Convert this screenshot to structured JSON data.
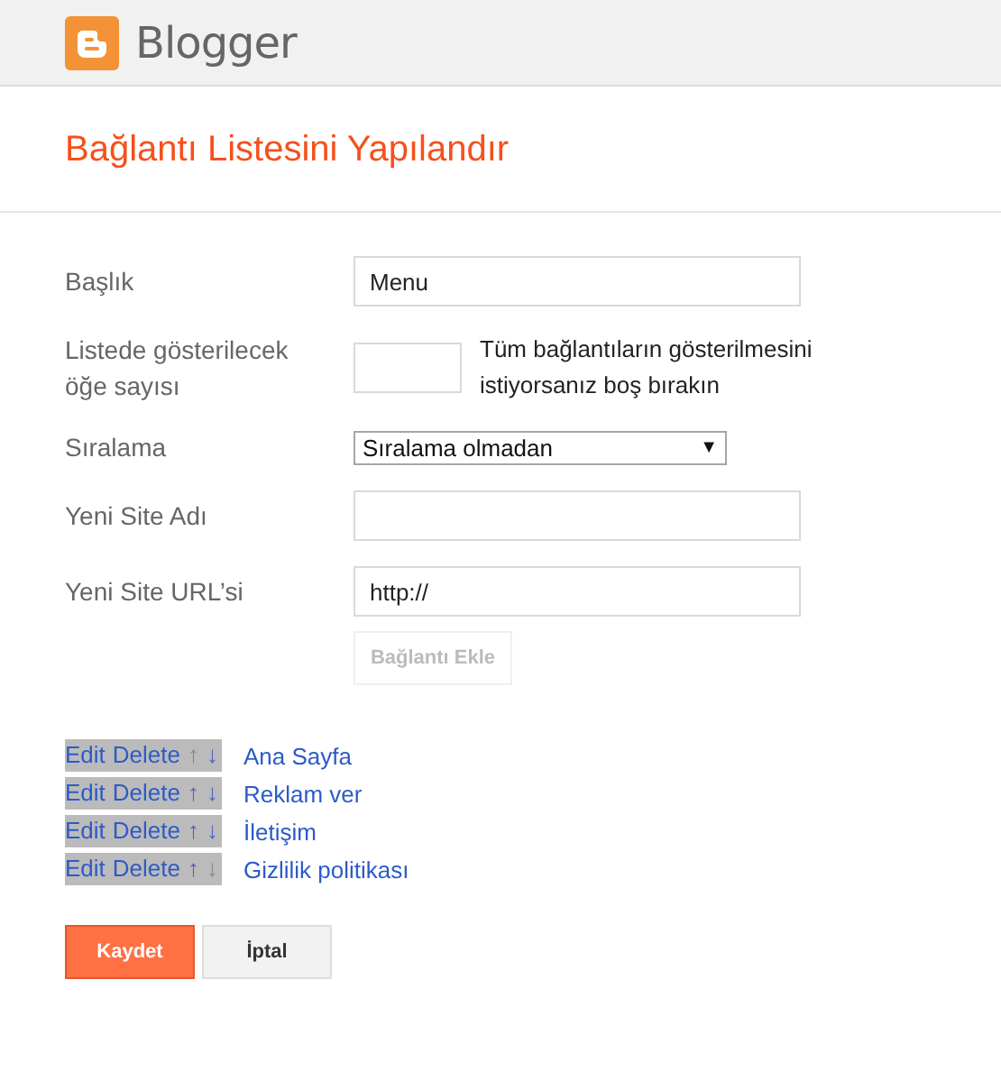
{
  "header": {
    "brand": "Blogger"
  },
  "title": "Bağlantı Listesini Yapılandır",
  "fields": [
    {
      "kind": "text",
      "label": "Başlık",
      "value": "Menu"
    },
    {
      "kind": "count",
      "label": "Listede gösterilecek öğe sayısı",
      "hint": "Tüm bağlantıların gösterilmesini istiyorsanız boş bırakın"
    },
    {
      "kind": "select",
      "label": "Sıralama",
      "value": "Sıralama olmadan",
      "arrow": "▼"
    },
    {
      "kind": "text",
      "label": "Yeni Site Adı"
    },
    {
      "kind": "text",
      "label": "Yeni Site URL’si",
      "value": "http://"
    }
  ],
  "add_button": {
    "label": "Bağlantı Ekle",
    "disabled": true
  },
  "links": [
    {
      "edit": "Edit",
      "delete": "Delete",
      "up": "↑",
      "down": "↓",
      "up_disabled": true,
      "down_disabled": false,
      "name": "Ana Sayfa"
    },
    {
      "edit": "Edit",
      "delete": "Delete",
      "up": "↑",
      "down": "↓",
      "up_disabled": false,
      "down_disabled": false,
      "name": "Reklam ver"
    },
    {
      "edit": "Edit",
      "delete": "Delete",
      "up": "↑",
      "down": "↓",
      "up_disabled": false,
      "down_disabled": false,
      "name": "İletişim"
    },
    {
      "edit": "Edit",
      "delete": "Delete",
      "up": "↑",
      "down": "↓",
      "up_disabled": false,
      "down_disabled": true,
      "name": "Gizlilik politikası"
    }
  ],
  "buttons": [
    {
      "kind": "primary",
      "label": "Kaydet"
    },
    {
      "kind": "secondary",
      "label": "İptal"
    }
  ]
}
